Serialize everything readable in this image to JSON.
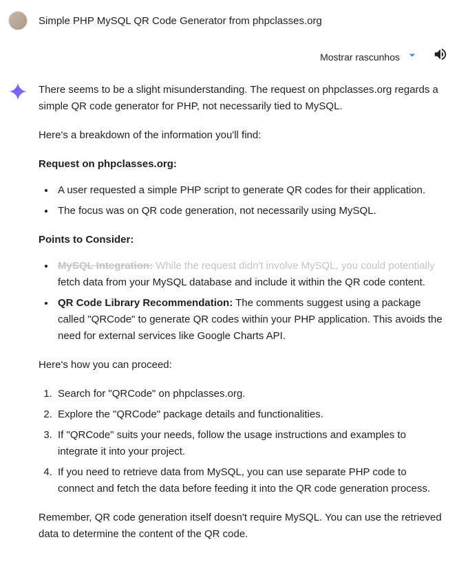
{
  "user": {
    "message": "Simple PHP MySQL QR Code Generator from phpclasses.org"
  },
  "controls": {
    "show_drafts_label": "Mostrar rascunhos"
  },
  "ai": {
    "p1": "There seems to be a slight misunderstanding. The request on phpclasses.org regards a simple QR code generator for PHP, not necessarily tied to MySQL.",
    "p2": "Here's a breakdown of the information you'll find:",
    "h1": "Request on phpclasses.org:",
    "b1_li1": "A user requested a simple PHP script to generate QR codes for their application.",
    "b1_li2": "The focus was on QR code generation, not necessarily using MySQL.",
    "h2": "Points to Consider:",
    "b2_li1_bold": "MySQL Integration:",
    "b2_li1_ghost": " While the request didn't involve MySQL, you could potentially",
    "b2_li1_rest": "fetch data from your MySQL database and include it within the QR code content.",
    "b2_li2_bold": "QR Code Library Recommendation:",
    "b2_li2_rest": " The comments suggest using a package called \"QRCode\" to generate QR codes within your PHP application. This avoids the need for external services like Google Charts API.",
    "p3": "Here's how you can proceed:",
    "ol_li1": "Search for \"QRCode\" on phpclasses.org.",
    "ol_li2": "Explore the \"QRCode\" package details and functionalities.",
    "ol_li3": "If \"QRCode\" suits your needs, follow the usage instructions and examples to integrate it into your project.",
    "ol_li4": "If you need to retrieve data from MySQL, you can use separate PHP code to connect and fetch the data before feeding it into the QR code generation process.",
    "p4": "Remember, QR code generation itself doesn't require MySQL. You can use the retrieved data to determine the content of the QR code."
  }
}
